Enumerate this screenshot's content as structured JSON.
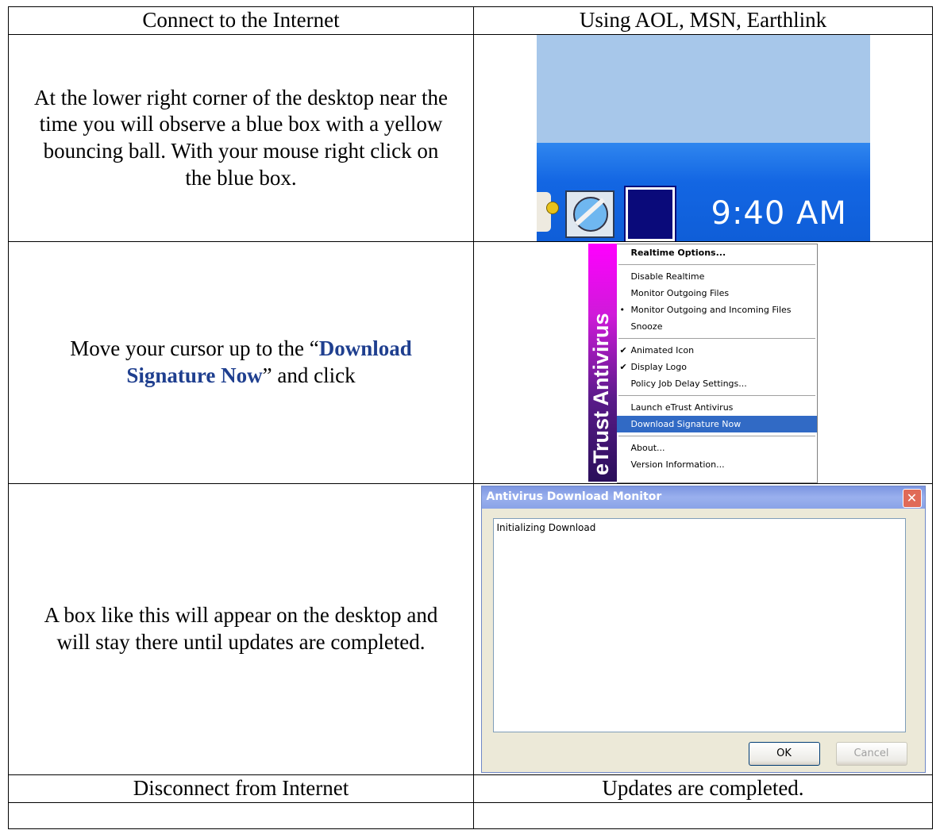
{
  "table": {
    "header": {
      "left": "Connect to the Internet",
      "right": "Using AOL, MSN, Earthlink"
    },
    "step1": {
      "text": "At the lower right corner of the desktop near the time you will observe a blue box with a yellow bouncing ball. With your mouse right click on the blue box.",
      "tray_time": "9:40 AM"
    },
    "step2": {
      "text_before": "Move your cursor up to the “",
      "highlight": "Download Signature Now",
      "text_after": "” and click"
    },
    "step3": {
      "text": "A box like this will appear on the desktop and will stay there until updates are completed."
    },
    "footer": {
      "left": "Disconnect from Internet",
      "right": "Updates are completed."
    }
  },
  "context_menu": {
    "banner": "eTrust Antivirus",
    "items": [
      {
        "label": "Realtime Options...",
        "bold": true,
        "mark": ""
      },
      {
        "separator": true
      },
      {
        "label": "Disable Realtime",
        "mark": ""
      },
      {
        "label": "Monitor Outgoing Files",
        "mark": ""
      },
      {
        "label": "Monitor Outgoing and Incoming Files",
        "mark": "•"
      },
      {
        "label": "Snooze",
        "mark": ""
      },
      {
        "separator": true
      },
      {
        "label": "Animated Icon",
        "mark": "✔"
      },
      {
        "label": "Display Logo",
        "mark": "✔"
      },
      {
        "label": "Policy Job Delay Settings...",
        "mark": ""
      },
      {
        "separator": true
      },
      {
        "label": "Launch eTrust Antivirus",
        "mark": ""
      },
      {
        "label": "Download Signature Now",
        "mark": "",
        "selected": true
      },
      {
        "separator": true
      },
      {
        "label": "About...",
        "mark": ""
      },
      {
        "label": "Version Information...",
        "mark": ""
      }
    ]
  },
  "dialog": {
    "title": "Antivirus Download Monitor",
    "close": "✕",
    "log": "Initializing Download",
    "ok": "OK",
    "cancel": "Cancel"
  },
  "colors": {
    "highlight_text": "#1f3f8f",
    "menu_selection": "#316ac5",
    "taskbar": "#1366e3"
  }
}
